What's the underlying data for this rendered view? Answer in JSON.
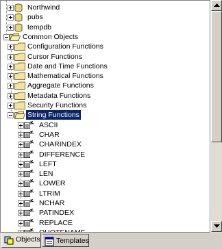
{
  "tree": {
    "nodes": [
      {
        "label": "Northwind",
        "icon": "database",
        "expander": "plus",
        "level": 1,
        "selected": false
      },
      {
        "label": "pubs",
        "icon": "database",
        "expander": "plus",
        "level": 1,
        "selected": false
      },
      {
        "label": "tempdb",
        "icon": "database",
        "expander": "plus",
        "level": 1,
        "selected": false
      },
      {
        "label": "Common Objects",
        "icon": "folder-open",
        "expander": "minus",
        "level": 0,
        "selected": false
      },
      {
        "label": "Configuration Functions",
        "icon": "folder",
        "expander": "plus",
        "level": 1,
        "selected": false
      },
      {
        "label": "Cursor Functions",
        "icon": "folder",
        "expander": "plus",
        "level": 1,
        "selected": false
      },
      {
        "label": "Date and Time Functions",
        "icon": "folder",
        "expander": "plus",
        "level": 1,
        "selected": false
      },
      {
        "label": "Mathematical Functions",
        "icon": "folder",
        "expander": "plus",
        "level": 1,
        "selected": false
      },
      {
        "label": "Aggregate Functions",
        "icon": "folder",
        "expander": "plus",
        "level": 1,
        "selected": false
      },
      {
        "label": "Metadata Functions",
        "icon": "folder",
        "expander": "plus",
        "level": 1,
        "selected": false
      },
      {
        "label": "Security Functions",
        "icon": "folder",
        "expander": "plus",
        "level": 1,
        "selected": false
      },
      {
        "label": "String Functions",
        "icon": "folder-open",
        "expander": "minus",
        "level": 1,
        "selected": true
      },
      {
        "label": "ASCII",
        "icon": "function",
        "expander": "plus",
        "level": 2,
        "selected": false
      },
      {
        "label": "CHAR",
        "icon": "function",
        "expander": "plus",
        "level": 2,
        "selected": false
      },
      {
        "label": "CHARINDEX",
        "icon": "function",
        "expander": "plus",
        "level": 2,
        "selected": false
      },
      {
        "label": "DIFFERENCE",
        "icon": "function",
        "expander": "plus",
        "level": 2,
        "selected": false
      },
      {
        "label": "LEFT",
        "icon": "function",
        "expander": "plus",
        "level": 2,
        "selected": false
      },
      {
        "label": "LEN",
        "icon": "function",
        "expander": "plus",
        "level": 2,
        "selected": false
      },
      {
        "label": "LOWER",
        "icon": "function",
        "expander": "plus",
        "level": 2,
        "selected": false
      },
      {
        "label": "LTRIM",
        "icon": "function",
        "expander": "plus",
        "level": 2,
        "selected": false
      },
      {
        "label": "NCHAR",
        "icon": "function",
        "expander": "plus",
        "level": 2,
        "selected": false
      },
      {
        "label": "PATINDEX",
        "icon": "function",
        "expander": "plus",
        "level": 2,
        "selected": false
      },
      {
        "label": "REPLACE",
        "icon": "function",
        "expander": "plus",
        "level": 2,
        "selected": false
      },
      {
        "label": "QUOTENAME",
        "icon": "function",
        "expander": "plus",
        "level": 2,
        "selected": false
      }
    ]
  },
  "tabs": [
    {
      "label": "Objects",
      "icon": "objects-tab-icon",
      "active": true
    },
    {
      "label": "Templates",
      "icon": "templates-tab-icon",
      "active": false
    }
  ],
  "colors": {
    "selection": "#0a246a",
    "folder": "#f4e3a0",
    "database": "#e8d870",
    "background": "#d4d0c8"
  }
}
